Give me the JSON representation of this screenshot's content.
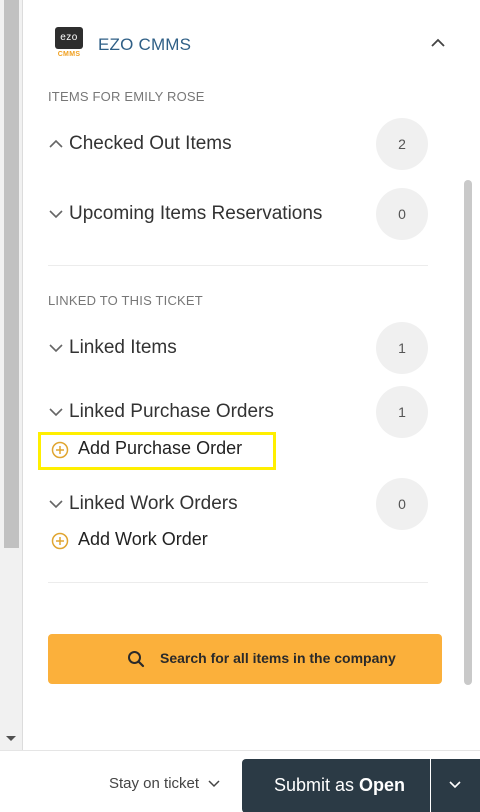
{
  "app": {
    "logo_text": "ezo",
    "logo_sub": "CMMS",
    "title": "EZO CMMS"
  },
  "icons": {
    "collapse": "chevron-up-icon",
    "expand": "chevron-down-icon",
    "add": "plus-circle-icon",
    "search": "search-icon"
  },
  "colors": {
    "title_blue": "#2f5f86",
    "accent_orange": "#fbb03b",
    "highlight_yellow": "#ffef00",
    "submit_dark": "#2b3a45"
  },
  "user_section": {
    "title": "ITEMS FOR EMILY ROSE",
    "items": [
      {
        "label": "Checked Out Items",
        "count": "2",
        "expanded": true
      },
      {
        "label": "Upcoming Items Reservations",
        "count": "0",
        "expanded": false
      }
    ]
  },
  "ticket_section": {
    "title": "LINKED TO THIS TICKET",
    "items": [
      {
        "label": "Linked Items",
        "count": "1"
      },
      {
        "label": "Linked Purchase Orders",
        "count": "1",
        "action": "Add Purchase Order"
      },
      {
        "label": "Linked Work Orders",
        "count": "0",
        "action": "Add Work Order"
      }
    ]
  },
  "search_button": {
    "label": "Search for all items in the company"
  },
  "footer": {
    "stay_label": "Stay on ticket",
    "submit_prefix": "Submit as ",
    "submit_status": "Open"
  }
}
